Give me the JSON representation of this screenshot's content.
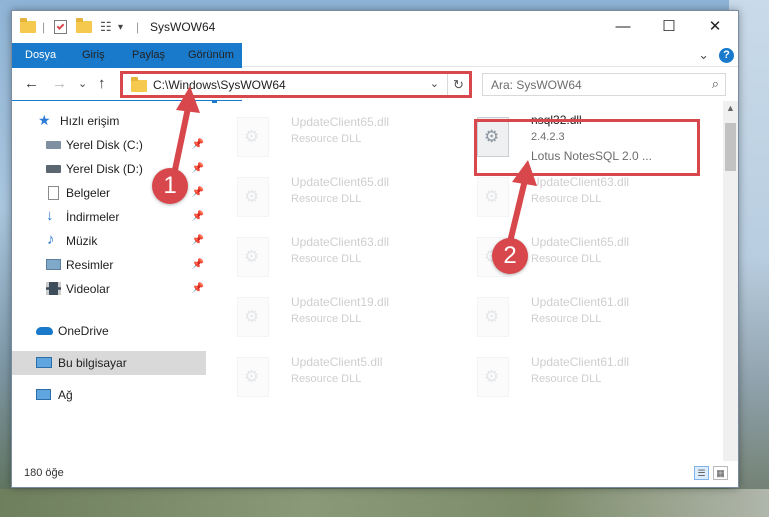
{
  "window": {
    "title": "SysWOW64",
    "controls": {
      "minimize": "—",
      "maximize": "☐",
      "close": "✕"
    }
  },
  "ribbon": {
    "tabs": [
      {
        "label": "Dosya",
        "active": true
      },
      {
        "label": "Giriş"
      },
      {
        "label": "Paylaş"
      },
      {
        "label": "Görünüm"
      }
    ],
    "expand": "⌄",
    "help": "?"
  },
  "nav": {
    "back": "←",
    "forward": "→",
    "recent": "⌄",
    "up": "↑",
    "address": "C:\\Windows\\SysWOW64",
    "dropdown": "⌄",
    "refresh": "↻",
    "search_placeholder": "Ara: SysWOW64",
    "search_icon": "⌕"
  },
  "sidebar": {
    "items": [
      {
        "label": "Hızlı erişim",
        "icon": "star-icon"
      },
      {
        "label": "Yerel Disk (C:)",
        "icon": "drive-icon",
        "pinned": true
      },
      {
        "label": "Yerel Disk (D:)",
        "icon": "drive-icon",
        "pinned": true
      },
      {
        "label": "Belgeler",
        "icon": "documents-icon",
        "pinned": true
      },
      {
        "label": "İndirmeler",
        "icon": "download-icon",
        "pinned": true
      },
      {
        "label": "Müzik",
        "icon": "music-icon",
        "pinned": true
      },
      {
        "label": "Resimler",
        "icon": "pictures-icon",
        "pinned": true
      },
      {
        "label": "Videolar",
        "icon": "videos-icon",
        "pinned": true
      },
      {
        "label": "OneDrive",
        "icon": "cloud-icon"
      },
      {
        "label": "Bu bilgisayar",
        "icon": "computer-icon",
        "selected": true
      },
      {
        "label": "Ağ",
        "icon": "network-icon"
      }
    ],
    "pin_glyph": "📌"
  },
  "files": {
    "left": [
      {
        "name": "UpdateClient65.dll",
        "type": "Resource DLL"
      },
      {
        "name": "UpdateClient65.dll",
        "type": "Resource DLL"
      },
      {
        "name": "UpdateClient63.dll",
        "type": "Resource DLL"
      },
      {
        "name": "UpdateClient19.dll",
        "type": "Resource DLL"
      },
      {
        "name": "UpdateClient5.dll",
        "type": "Resource DLL"
      }
    ],
    "highlighted": {
      "name": "nsql32.dll",
      "version": "2.4.2.3",
      "description": "Lotus NotesSQL 2.0 ..."
    },
    "right": [
      {
        "name": "UpdateClient63.dll",
        "type": "Resource DLL"
      },
      {
        "name": "UpdateClient65.dll",
        "type": "Resource DLL"
      },
      {
        "name": "UpdateClient61.dll",
        "type": "Resource DLL"
      },
      {
        "name": "UpdateClient61.dll",
        "type": "Resource DLL"
      }
    ]
  },
  "status": {
    "count": "180 öğe"
  },
  "annotations": {
    "callout1": "1",
    "callout2": "2",
    "color": "#d8474c"
  },
  "colors": {
    "accent": "#1979ca",
    "highlight": "#d8474c",
    "folder": "#f4c94e"
  }
}
